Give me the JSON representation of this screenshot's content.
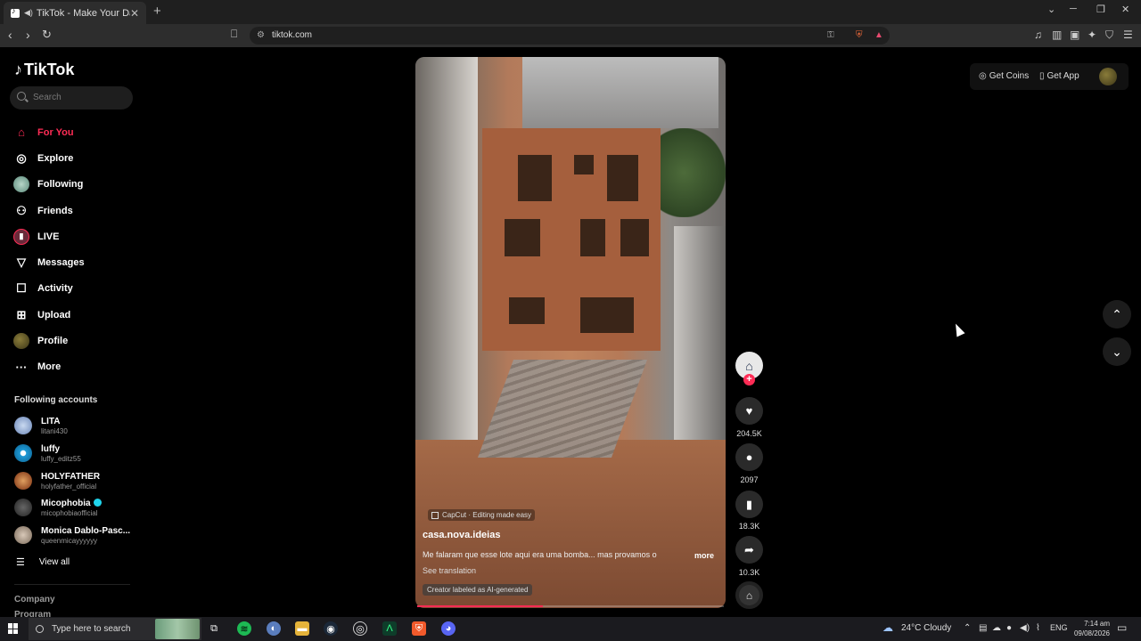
{
  "browser": {
    "tab_title": "TikTok - Make Your Day",
    "url": "tiktok.com"
  },
  "sidebar": {
    "logo": "TikTok",
    "search_placeholder": "Search",
    "nav": [
      {
        "label": "For You",
        "icon": "home-icon",
        "active": true
      },
      {
        "label": "Explore",
        "icon": "compass-icon"
      },
      {
        "label": "Following",
        "icon": "following-avatar"
      },
      {
        "label": "Friends",
        "icon": "friends-icon"
      },
      {
        "label": "LIVE",
        "icon": "live-icon"
      },
      {
        "label": "Messages",
        "icon": "messages-icon"
      },
      {
        "label": "Activity",
        "icon": "activity-icon"
      },
      {
        "label": "Upload",
        "icon": "upload-icon"
      },
      {
        "label": "Profile",
        "icon": "profile-avatar"
      },
      {
        "label": "More",
        "icon": "more-icon"
      }
    ],
    "following_title": "Following accounts",
    "accounts": [
      {
        "name": "LITA",
        "handle": "litani430"
      },
      {
        "name": "luffy",
        "handle": "luffy_editz55"
      },
      {
        "name": "HOLYFATHER",
        "handle": "holyfather_official"
      },
      {
        "name": "Micophobia",
        "handle": "micophobiaofficial",
        "verified": true
      },
      {
        "name": "Monica Dablo-Pasc...",
        "handle": "queenmicayyyyyy"
      }
    ],
    "view_all": "View all",
    "footer": {
      "company": "Company",
      "program": "Program"
    }
  },
  "header": {
    "get_coins": "Get Coins",
    "get_app": "Get App"
  },
  "video": {
    "capcut_label": "CapCut · Editing made easy",
    "author": "casa.nova.ideias",
    "description": "Me falaram que esse lote aqui era uma bomba... mas provamos o",
    "more": "more",
    "see_translation": "See translation",
    "ai_label": "Creator labeled as AI-generated",
    "progress": 0.41
  },
  "actions": {
    "likes": "204.5K",
    "comments": "2097",
    "saves": "18.3K",
    "shares": "10.3K"
  },
  "taskbar": {
    "search_placeholder": "Type here to search",
    "weather": "24°C  Cloudy",
    "lang": "ENG",
    "time": "7:14 am",
    "date": "09/08/2026"
  },
  "colors": {
    "accent": "#fe2c55",
    "background": "#000000"
  }
}
